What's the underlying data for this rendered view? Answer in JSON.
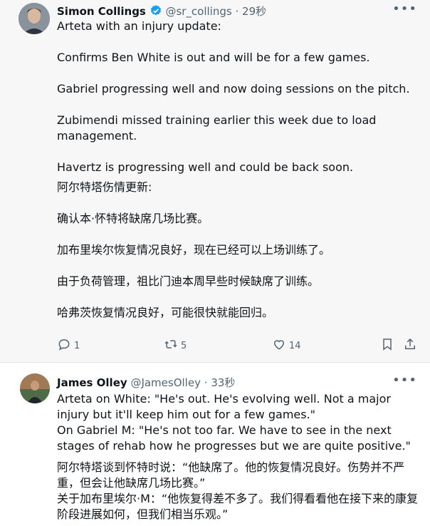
{
  "tweet1": {
    "author_name": "Simon Collings",
    "handle": "@sr_collings",
    "sep": "·",
    "time": "29秒",
    "paragraphs_en": [
      "Arteta with an injury update:",
      "Confirms Ben White is out and will be for a few games.",
      "Gabriel progressing well and now doing sessions on the pitch.",
      "Zubimendi missed training earlier this week due to load management.",
      "Havertz is progressing well and could be back soon."
    ],
    "paragraphs_zh": [
      "阿尔特塔伤情更新:",
      "确认本·怀特将缺席几场比赛。",
      "加布里埃尔恢复情况良好，现在已经可以上场训练了。",
      "由于负荷管理，祖比门迪本周早些时候缺席了训练。",
      "哈弗茨恢复情况良好，可能很快就能回归。"
    ],
    "counts": {
      "replies": "1",
      "retweets": "5",
      "likes": "14"
    }
  },
  "tweet2": {
    "author_name": "James Olley",
    "handle": "@JamesOlley",
    "sep": "·",
    "time": "33秒",
    "lines": [
      "Arteta on White: \"He's out. He's evolving well. Not a major injury but it'll keep him out for a few games.\"",
      "On Gabriel M: \"He's not too far. We have to see in the next stages of rehab how he progresses but we are quite positive.\"",
      "阿尔特塔谈到怀特时说：“他缺席了。他的恢复情况良好。伤势并不严重，但会让他缺席几场比赛。”",
      "关于加布里埃尔·M：“他恢复得差不多了。我们得看看他在接下来的康复阶段进展如何，但我们相当乐观。”"
    ]
  },
  "colors": {
    "accent": "#1d9bf0",
    "muted": "#536471",
    "text": "#0f1419"
  }
}
